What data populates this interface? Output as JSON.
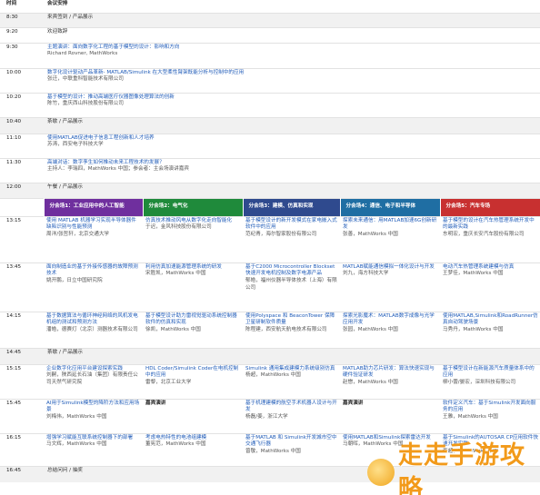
{
  "header": {
    "time": "时间",
    "agenda": "会议安排"
  },
  "rows_top": [
    {
      "time": "8:30",
      "lines": [
        {
          "t": "来宾签到 / 产品展示",
          "k": "plain"
        }
      ],
      "gray": true
    },
    {
      "time": "9:20",
      "lines": [
        {
          "t": "欢迎致辞",
          "k": "plain"
        }
      ],
      "gray": false
    },
    {
      "time": "9:30",
      "lines": [
        {
          "t": "主题演讲：面向数字化工程的基于模型的设计：影响和方向",
          "k": "link"
        },
        {
          "t": "Richard Rovner, MathWorks",
          "k": "sub"
        }
      ],
      "gray": false
    },
    {
      "time": "10:00",
      "lines": [
        {
          "t": "数字化设计驱动产品革新- MATLAB/Simulink 在大型柔性臂架既能分析与控制中的应用",
          "k": "link"
        },
        {
          "t": "张迁，中联重科智能技术有限公司",
          "k": "sub"
        }
      ],
      "gray": false
    },
    {
      "time": "10:20",
      "lines": [
        {
          "t": "基于模型的设计：推动高端医疗仪器图像处理算法的创新",
          "k": "link"
        },
        {
          "t": "陈竹，重庆西山科技股份有限公司",
          "k": "sub"
        }
      ],
      "gray": false
    },
    {
      "time": "10:40",
      "lines": [
        {
          "t": "茶歇 / 产品展示",
          "k": "plain"
        }
      ],
      "gray": true
    },
    {
      "time": "11:10",
      "lines": [
        {
          "t": "使用MATLAB促进电子信息工程创新和人才培养",
          "k": "link"
        },
        {
          "t": "苏涛，西安电子科技大学",
          "k": "sub"
        }
      ],
      "gray": false
    },
    {
      "time": "11:30",
      "lines": [
        {
          "t": "高端对话：数字孪生如何推动未来工程技术的发展？",
          "k": "link"
        },
        {
          "t": "主持人：李瑞四，MathWorks 中国；参会者：主会场演讲嘉宾",
          "k": "sub"
        }
      ],
      "gray": false
    },
    {
      "time": "12:00",
      "lines": [
        {
          "t": "午餐 / 产品展示",
          "k": "plain"
        }
      ],
      "gray": true
    }
  ],
  "tracks": [
    "分会场1：工业应用中的人工智能",
    "分会场2：电气化",
    "分会场3：建模、仿真和实现",
    "分会场4：通信、电子和半导体",
    "分会场5：汽车专场"
  ],
  "sessions_a": [
    {
      "time": "13:15",
      "cells": [
        {
          "t": "使用 MATLAB 机器学习实现半导体器件缺陷识别与性能预测",
          "s": "周洋/张哲轩，北京交通大学"
        },
        {
          "t": "仿真技术推动风电从数字化走向智能化",
          "s": "于迟，金风科技股份有限公司"
        },
        {
          "t": "基于模型设计的新开发模式在家电嵌入式软件中的应用",
          "s": "范纪青，海尔智家股份有限公司"
        },
        {
          "t": "探索未来通信：用MATLAB加速6G创新研发",
          "s": "张善，MathWorks 中国"
        },
        {
          "t": "基于模型的设计在汽车热管理系统开发中的最新实践",
          "s": "东明宏，重庆长安汽车股份有限公司"
        }
      ]
    },
    {
      "time": "13:45",
      "cells": [
        {
          "t": "面向制造业的基于外接传感器的故障预测技术",
          "s": "姚开鹏，日立中国研究院"
        },
        {
          "t": "利用仿真加速能源管理系统的研发",
          "s": "宋胜凯，MathWorks 中国"
        },
        {
          "t": "基于C2000 Microcontroller Blockset快速开发电机控制及数字电源产品",
          "s": "郁皓，福州仪器半导体技术（上海）有限公司"
        },
        {
          "t": "MATLAB赋能通信模拟一体化设计与开发",
          "s": "刘九，海方科技大学"
        },
        {
          "t": "电动汽车热管理系统建模与仿真",
          "s": "王梦佳，MathWorks 中国"
        }
      ]
    },
    {
      "time": "14:15",
      "cells": [
        {
          "t": "基于数据算法与循环神经网络的风机发电机组的测试和预测方法",
          "s": "潘皓，德赛灯（北京）测器技术有限公司"
        },
        {
          "t": "基于模型设计助力雷视觉驱动系统控制器软件的仿真和实现",
          "s": "徐凯，MathWorks 中国"
        },
        {
          "t": "使用Polyspace 和 BeaconTower 保障卫星研制软件质量",
          "s": "陈程建，西安航天航电技术有限公司"
        },
        {
          "t": "探索光影魔术：MATLAB数字成像与光学应用开发",
          "s": "张园，MathWorks 中国"
        },
        {
          "t": "使用MATLAB,Simulink和RoadRunner仿真自动驾驶场景",
          "s": "马秀丹，MathWorks 中国"
        }
      ]
    }
  ],
  "break_mid": {
    "time": "14:45",
    "text": "茶歇 / 产品展示"
  },
  "sessions_b": [
    {
      "time": "15:15",
      "cells": [
        {
          "t": "企业数字化应用平台建设探索实践",
          "s": "刘嗣，陕西延长石油（集团）有限责任公司天然气研究院"
        },
        {
          "t": "HDL Coder/Simulink Coder在电机控制中的应用",
          "s": "雷黎，北京工业大学"
        },
        {
          "t": "Simulink 通用集成建模力系统级别仿真",
          "s": "杨超，MathWorks 中国"
        },
        {
          "t": "MATLAB助力芯片研发：算法快速实现与硬件验证研发",
          "s": "赵懋，MathWorks 中国"
        },
        {
          "t": "基于模型设计在新能源汽车质量体系中的应用",
          "s": "柳小蕾/晏宏，深圳科技有限公司"
        }
      ]
    },
    {
      "time": "15:45",
      "cells": [
        {
          "t": "AI用于Simulink模型的降阶方法和应用场景",
          "s": "刘梅伟，MathWorks 中国"
        },
        {
          "t": "嘉宾演讲",
          "s": "",
          "b": true
        },
        {
          "t": "基于机理建模的航空手术机器人设计与开发",
          "s": "杨磊/姜，浙江大学"
        },
        {
          "t": "嘉宾演讲",
          "s": "",
          "b": true
        },
        {
          "t": "软件定义汽车：基于Simulink开发面向服务的应用",
          "s": "王雅，MathWorks 中国"
        }
      ]
    },
    {
      "time": "16:15",
      "cells": [
        {
          "t": "增强学习赋能互联系统控制器下的部署",
          "s": "马文辉，MathWorks 中国"
        },
        {
          "t": "考虑电热特性的电池组建模",
          "s": "董宪范，MathWorks 中国"
        },
        {
          "t": "基于MATLAB 和 Simulink开发城市空中交通飞行器",
          "s": "曾敬，MathWorks 中国"
        },
        {
          "t": "使用MATLAB和Simulink探索雷达开发",
          "s": "马朝晖，MathWorks 中国"
        },
        {
          "t": "基于Simulink的AUTOSAR CP应用软件快速开发实践",
          "s": "李超，MathWorks 中国"
        }
      ]
    }
  ],
  "row_end": {
    "time": "16:45",
    "text": "总结问问 / 抽奖"
  },
  "watermark": {
    "text": "走走手游攻略"
  },
  "colors": {
    "link": "#1f5bb8",
    "track1": "#6f2f9e",
    "track2": "#1f8a3b",
    "track3": "#2f4a8e",
    "track4": "#1f6ea3",
    "track5": "#c83030"
  }
}
